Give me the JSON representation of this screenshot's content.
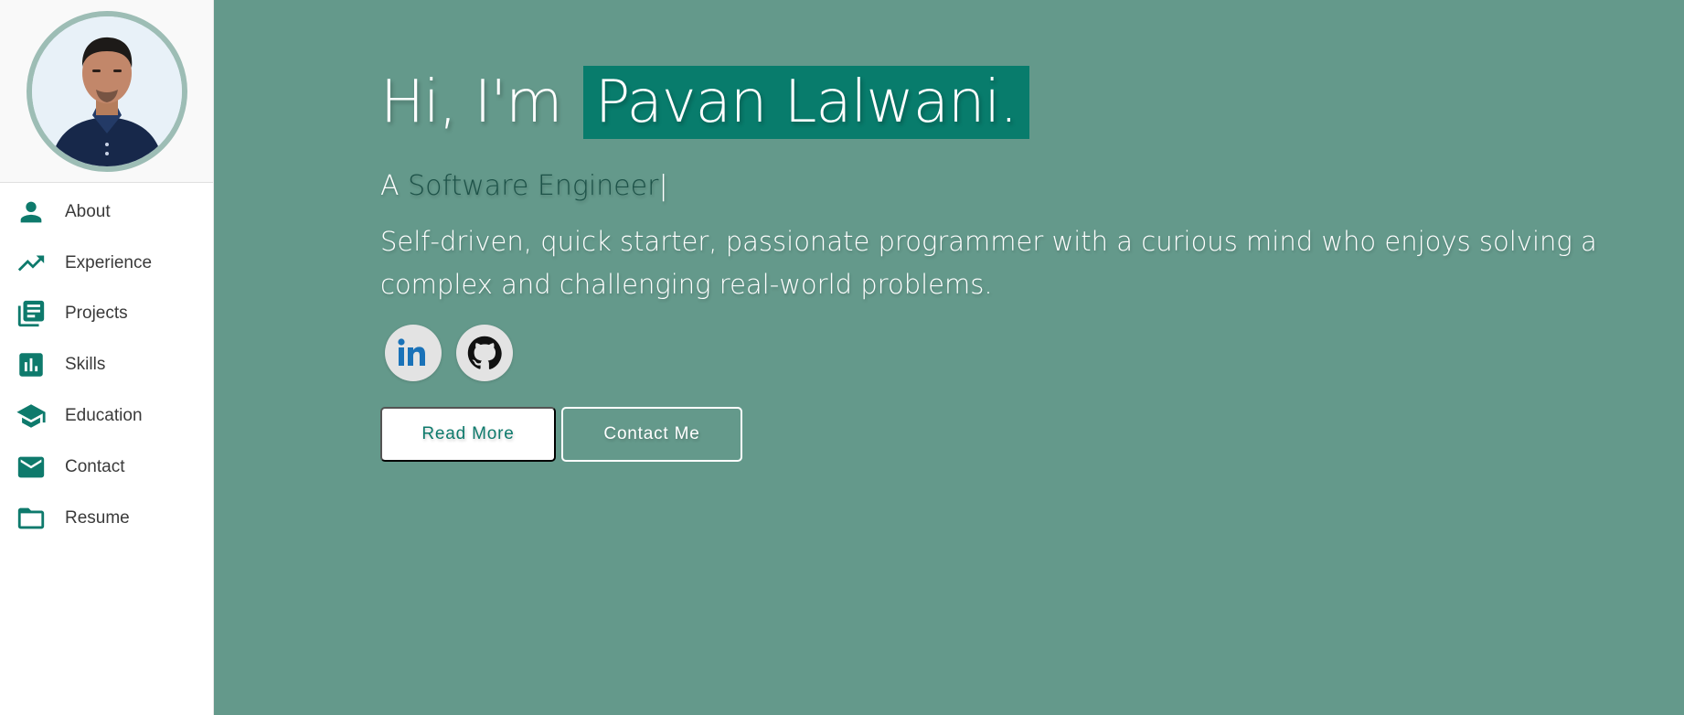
{
  "sidebar": {
    "profile_alt": "Profile photo",
    "items": [
      {
        "label": "About",
        "icon": "person-icon"
      },
      {
        "label": "Experience",
        "icon": "trending-up-icon"
      },
      {
        "label": "Projects",
        "icon": "library-books-icon"
      },
      {
        "label": "Skills",
        "icon": "bar-chart-icon"
      },
      {
        "label": "Education",
        "icon": "school-icon"
      },
      {
        "label": "Contact",
        "icon": "mail-icon"
      },
      {
        "label": "Resume",
        "icon": "folder-icon"
      }
    ]
  },
  "hero": {
    "greeting": "Hi, I'm",
    "name": "Pavan Lalwani.",
    "tagline_prefix": "A",
    "role": "Software Engineer",
    "caret": "|",
    "bio": "Self-driven, quick starter, passionate programmer with a curious mind who enjoys solving a complex and challenging real-world problems.",
    "socials": [
      {
        "icon": "linkedin-icon"
      },
      {
        "icon": "github-icon"
      }
    ],
    "buttons": {
      "read_more": "Read More",
      "contact": "Contact Me"
    }
  },
  "colors": {
    "accent": "#0e7a6c",
    "main_background": "#64998b",
    "name_highlight": "#087c6c",
    "role_text": "#1d5248"
  }
}
